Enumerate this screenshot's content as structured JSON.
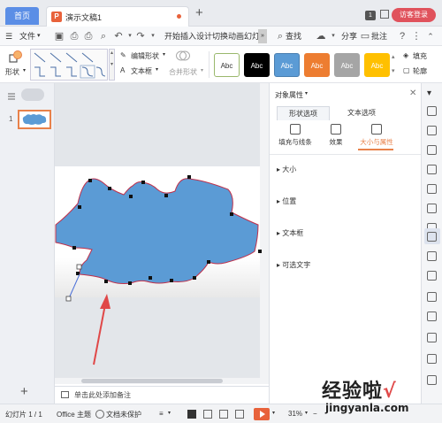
{
  "tabs": {
    "home": "首页",
    "doc_title": "演示文稿1",
    "badge": "1",
    "login": "访客登录"
  },
  "menu": {
    "file": "文件",
    "items": [
      "开始",
      "插入",
      "设计",
      "切换",
      "动画",
      "幻灯"
    ],
    "search": "查找",
    "share": "分享",
    "comment": "批注"
  },
  "ribbon": {
    "shape_label": "形状",
    "edit_shape": "编辑形状",
    "textbox": "文本框",
    "merge_shape": "合并形状",
    "style_previews": [
      {
        "label": "Abc",
        "bg": "#ffffff",
        "fg": "#333333",
        "border": "#9ab86c"
      },
      {
        "label": "Abc",
        "bg": "#000000",
        "fg": "#ffffff",
        "border": "#000000"
      },
      {
        "label": "Abc",
        "bg": "#5b9bd5",
        "fg": "#ffffff",
        "border": "#4a7fb0"
      },
      {
        "label": "Abc",
        "bg": "#ed7d31",
        "fg": "#ffffff",
        "border": "#ed7d31"
      },
      {
        "label": "Abc",
        "bg": "#a5a5a5",
        "fg": "#ffffff",
        "border": "#a5a5a5"
      },
      {
        "label": "Abc",
        "bg": "#ffc000",
        "fg": "#ffffff",
        "border": "#ffc000"
      }
    ],
    "fill": "填充",
    "outline": "轮廓"
  },
  "slides": {
    "current_number": "1",
    "add": "+"
  },
  "notes_placeholder": "单击此处添加备注",
  "property_panel": {
    "title": "对象属性",
    "tabs": [
      "形状选项",
      "文本选项"
    ],
    "subtabs": [
      "填充与线条",
      "效果",
      "大小与属性"
    ],
    "sections": [
      "大小",
      "位置",
      "文本框",
      "可选文字"
    ]
  },
  "status": {
    "slide_info": "幻灯片 1 / 1",
    "theme": "Office 主题",
    "protect": "文档未保护",
    "zoom": "31%"
  },
  "watermark": {
    "line1": "经验啦",
    "check": "√",
    "line2": "jingyanla.com"
  },
  "colors": {
    "shape_fill": "#5b9bd5",
    "shape_outline": "#c0304a",
    "accent": "#e8814a",
    "arrow": "#e04848"
  }
}
